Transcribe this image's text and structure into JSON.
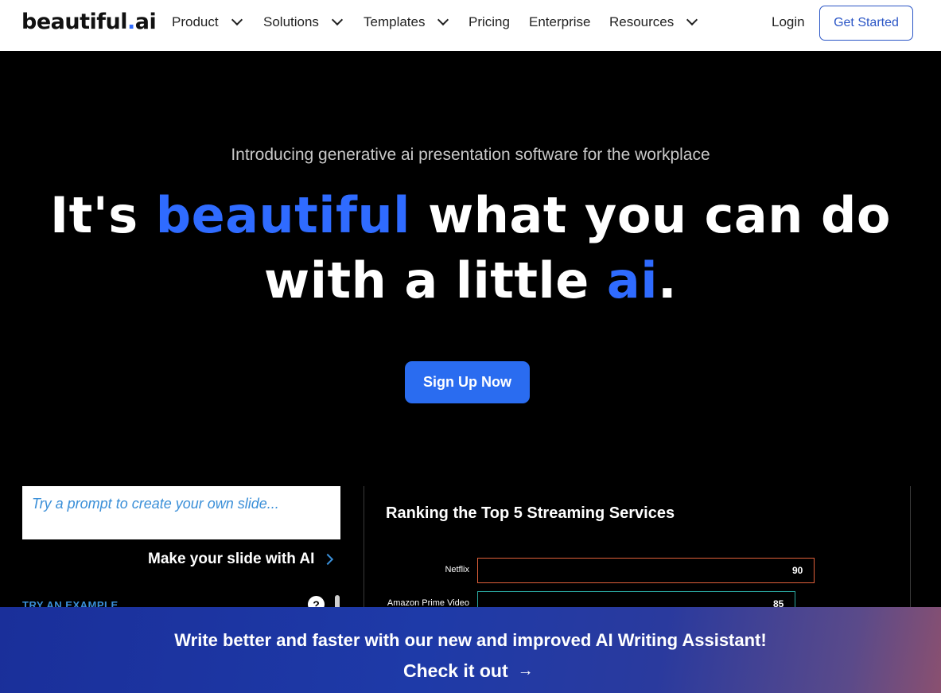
{
  "nav": {
    "logo_main": "beautiful",
    "logo_dot": ".",
    "logo_suffix": "ai",
    "items": [
      {
        "label": "Product",
        "dropdown": true
      },
      {
        "label": "Solutions",
        "dropdown": true
      },
      {
        "label": "Templates",
        "dropdown": true
      },
      {
        "label": "Pricing",
        "dropdown": false
      },
      {
        "label": "Enterprise",
        "dropdown": false
      },
      {
        "label": "Resources",
        "dropdown": true
      }
    ],
    "login": "Login",
    "get_started": "Get Started"
  },
  "hero": {
    "subtitle": "Introducing generative ai presentation software for the workplace",
    "line1_pre": "It's ",
    "line1_accent": "beautiful",
    "line1_post": " what you can do",
    "line2_pre": "with a little ",
    "line2_accent": "ai",
    "line2_post": ".",
    "signup": "Sign Up Now"
  },
  "prompt": {
    "placeholder": "Try a prompt to create your own slide...",
    "make_slide": "Make your slide with AI",
    "try_example": "TRY AN EXAMPLE",
    "help": "?"
  },
  "slide": {
    "title": "Ranking the Top 5 Streaming Services",
    "bars": [
      {
        "label": "Netflix",
        "value": 90,
        "color": "#e0603a"
      },
      {
        "label": "Amazon Prime Video",
        "value": 85,
        "color": "#2aa8a0"
      }
    ]
  },
  "banner": {
    "text": "Write better and faster with our new and improved AI Writing Assistant!",
    "cta": "Check it out",
    "arrow": "→"
  },
  "colors": {
    "accent": "#2f6bff",
    "signup_bg": "#2a6cf0",
    "link_blue": "#3a8fd8"
  }
}
